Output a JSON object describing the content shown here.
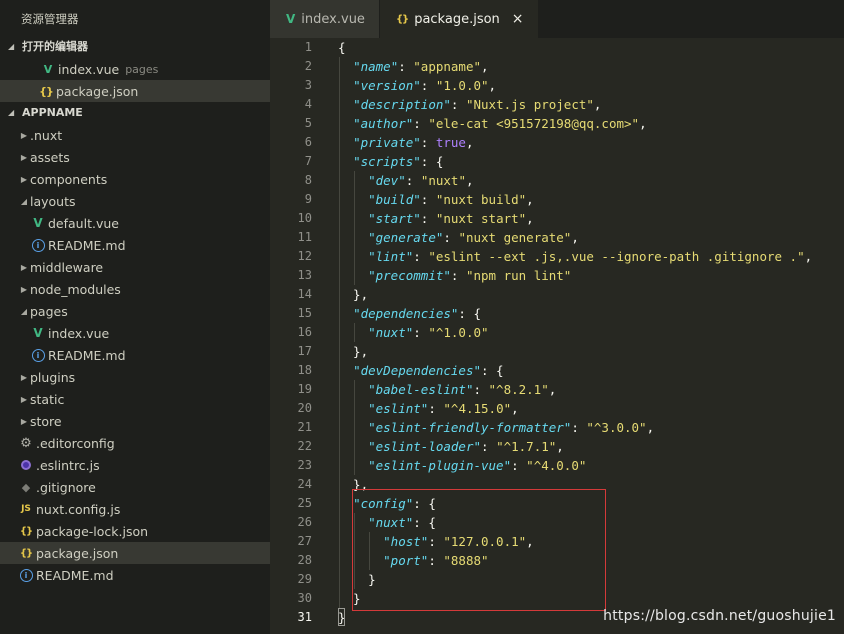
{
  "sidebar": {
    "title": "资源管理器",
    "open_editors": {
      "label": "打开的编辑器",
      "items": [
        {
          "name": "index.vue",
          "hint": "pages",
          "icon": "vue-icon"
        },
        {
          "name": "package.json",
          "hint": "",
          "icon": "json-icon"
        }
      ]
    },
    "project": {
      "label": "APPNAME",
      "items": [
        {
          "name": ".nuxt",
          "type": "folder"
        },
        {
          "name": "assets",
          "type": "folder"
        },
        {
          "name": "components",
          "type": "folder"
        },
        {
          "name": "layouts",
          "type": "folder-open"
        },
        {
          "name": "default.vue",
          "type": "vue"
        },
        {
          "name": "README.md",
          "type": "info"
        },
        {
          "name": "middleware",
          "type": "folder"
        },
        {
          "name": "node_modules",
          "type": "folder"
        },
        {
          "name": "pages",
          "type": "folder-open"
        },
        {
          "name": "index.vue",
          "type": "vue"
        },
        {
          "name": "README.md",
          "type": "info"
        },
        {
          "name": "plugins",
          "type": "folder"
        },
        {
          "name": "static",
          "type": "folder"
        },
        {
          "name": "store",
          "type": "folder"
        },
        {
          "name": ".editorconfig",
          "type": "gear"
        },
        {
          "name": ".eslintrc.js",
          "type": "eslint"
        },
        {
          "name": ".gitignore",
          "type": "diamond"
        },
        {
          "name": "nuxt.config.js",
          "type": "js"
        },
        {
          "name": "package-lock.json",
          "type": "json"
        },
        {
          "name": "package.json",
          "type": "json"
        },
        {
          "name": "README.md",
          "type": "info"
        }
      ]
    }
  },
  "tabs": [
    {
      "label": "index.vue",
      "icon": "vue-icon"
    },
    {
      "label": "package.json",
      "icon": "json-icon",
      "close": "×"
    }
  ],
  "editor": {
    "line_numbers": [
      "1",
      "2",
      "3",
      "4",
      "5",
      "6",
      "7",
      "8",
      "9",
      "10",
      "11",
      "12",
      "13",
      "14",
      "15",
      "16",
      "17",
      "18",
      "19",
      "20",
      "21",
      "22",
      "23",
      "24",
      "25",
      "26",
      "27",
      "28",
      "29",
      "30",
      "31"
    ],
    "current_line": 31,
    "lines": [
      [
        [
          "p",
          "{"
        ]
      ],
      [
        [
          "p",
          "  "
        ],
        [
          "k",
          "\"name\""
        ],
        [
          "p",
          ": "
        ],
        [
          "s",
          "\"appname\""
        ],
        [
          "p",
          ","
        ]
      ],
      [
        [
          "p",
          "  "
        ],
        [
          "k",
          "\"version\""
        ],
        [
          "p",
          ": "
        ],
        [
          "s",
          "\"1.0.0\""
        ],
        [
          "p",
          ","
        ]
      ],
      [
        [
          "p",
          "  "
        ],
        [
          "k",
          "\"description\""
        ],
        [
          "p",
          ": "
        ],
        [
          "s",
          "\"Nuxt.js project\""
        ],
        [
          "p",
          ","
        ]
      ],
      [
        [
          "p",
          "  "
        ],
        [
          "k",
          "\"author\""
        ],
        [
          "p",
          ": "
        ],
        [
          "s",
          "\"ele-cat <951572198@qq.com>\""
        ],
        [
          "p",
          ","
        ]
      ],
      [
        [
          "p",
          "  "
        ],
        [
          "k",
          "\"private\""
        ],
        [
          "p",
          ": "
        ],
        [
          "b",
          "true"
        ],
        [
          "p",
          ","
        ]
      ],
      [
        [
          "p",
          "  "
        ],
        [
          "k",
          "\"scripts\""
        ],
        [
          "p",
          ": {"
        ]
      ],
      [
        [
          "p",
          "    "
        ],
        [
          "k",
          "\"dev\""
        ],
        [
          "p",
          ": "
        ],
        [
          "s",
          "\"nuxt\""
        ],
        [
          "p",
          ","
        ]
      ],
      [
        [
          "p",
          "    "
        ],
        [
          "k",
          "\"build\""
        ],
        [
          "p",
          ": "
        ],
        [
          "s",
          "\"nuxt build\""
        ],
        [
          "p",
          ","
        ]
      ],
      [
        [
          "p",
          "    "
        ],
        [
          "k",
          "\"start\""
        ],
        [
          "p",
          ": "
        ],
        [
          "s",
          "\"nuxt start\""
        ],
        [
          "p",
          ","
        ]
      ],
      [
        [
          "p",
          "    "
        ],
        [
          "k",
          "\"generate\""
        ],
        [
          "p",
          ": "
        ],
        [
          "s",
          "\"nuxt generate\""
        ],
        [
          "p",
          ","
        ]
      ],
      [
        [
          "p",
          "    "
        ],
        [
          "k",
          "\"lint\""
        ],
        [
          "p",
          ": "
        ],
        [
          "s",
          "\"eslint --ext .js,.vue --ignore-path .gitignore .\""
        ],
        [
          "p",
          ","
        ]
      ],
      [
        [
          "p",
          "    "
        ],
        [
          "k",
          "\"precommit\""
        ],
        [
          "p",
          ": "
        ],
        [
          "s",
          "\"npm run lint\""
        ]
      ],
      [
        [
          "p",
          "  },"
        ]
      ],
      [
        [
          "p",
          "  "
        ],
        [
          "k",
          "\"dependencies\""
        ],
        [
          "p",
          ": {"
        ]
      ],
      [
        [
          "p",
          "    "
        ],
        [
          "k",
          "\"nuxt\""
        ],
        [
          "p",
          ": "
        ],
        [
          "s",
          "\"^1.0.0\""
        ]
      ],
      [
        [
          "p",
          "  },"
        ]
      ],
      [
        [
          "p",
          "  "
        ],
        [
          "k",
          "\"devDependencies\""
        ],
        [
          "p",
          ": {"
        ]
      ],
      [
        [
          "p",
          "    "
        ],
        [
          "k",
          "\"babel-eslint\""
        ],
        [
          "p",
          ": "
        ],
        [
          "s",
          "\"^8.2.1\""
        ],
        [
          "p",
          ","
        ]
      ],
      [
        [
          "p",
          "    "
        ],
        [
          "k",
          "\"eslint\""
        ],
        [
          "p",
          ": "
        ],
        [
          "s",
          "\"^4.15.0\""
        ],
        [
          "p",
          ","
        ]
      ],
      [
        [
          "p",
          "    "
        ],
        [
          "k",
          "\"eslint-friendly-formatter\""
        ],
        [
          "p",
          ": "
        ],
        [
          "s",
          "\"^3.0.0\""
        ],
        [
          "p",
          ","
        ]
      ],
      [
        [
          "p",
          "    "
        ],
        [
          "k",
          "\"eslint-loader\""
        ],
        [
          "p",
          ": "
        ],
        [
          "s",
          "\"^1.7.1\""
        ],
        [
          "p",
          ","
        ]
      ],
      [
        [
          "p",
          "    "
        ],
        [
          "k",
          "\"eslint-plugin-vue\""
        ],
        [
          "p",
          ": "
        ],
        [
          "s",
          "\"^4.0.0\""
        ]
      ],
      [
        [
          "p",
          "  },"
        ]
      ],
      [
        [
          "p",
          "  "
        ],
        [
          "k",
          "\"config\""
        ],
        [
          "p",
          ": {"
        ]
      ],
      [
        [
          "p",
          "    "
        ],
        [
          "k",
          "\"nuxt\""
        ],
        [
          "p",
          ": {"
        ]
      ],
      [
        [
          "p",
          "      "
        ],
        [
          "k",
          "\"host\""
        ],
        [
          "p",
          ": "
        ],
        [
          "s",
          "\"127.0.0.1\""
        ],
        [
          "p",
          ","
        ]
      ],
      [
        [
          "p",
          "      "
        ],
        [
          "k",
          "\"port\""
        ],
        [
          "p",
          ": "
        ],
        [
          "s",
          "\"8888\""
        ]
      ],
      [
        [
          "p",
          "    }"
        ]
      ],
      [
        [
          "p",
          "  }"
        ]
      ],
      [
        [
          "p",
          "}"
        ]
      ]
    ]
  },
  "watermark": "https://blog.csdn.net/guoshujie1",
  "colors": {
    "key": "#66d9ef",
    "string": "#e6db74",
    "boolean": "#ae81ff",
    "highlight_box": "#d43a3a"
  }
}
